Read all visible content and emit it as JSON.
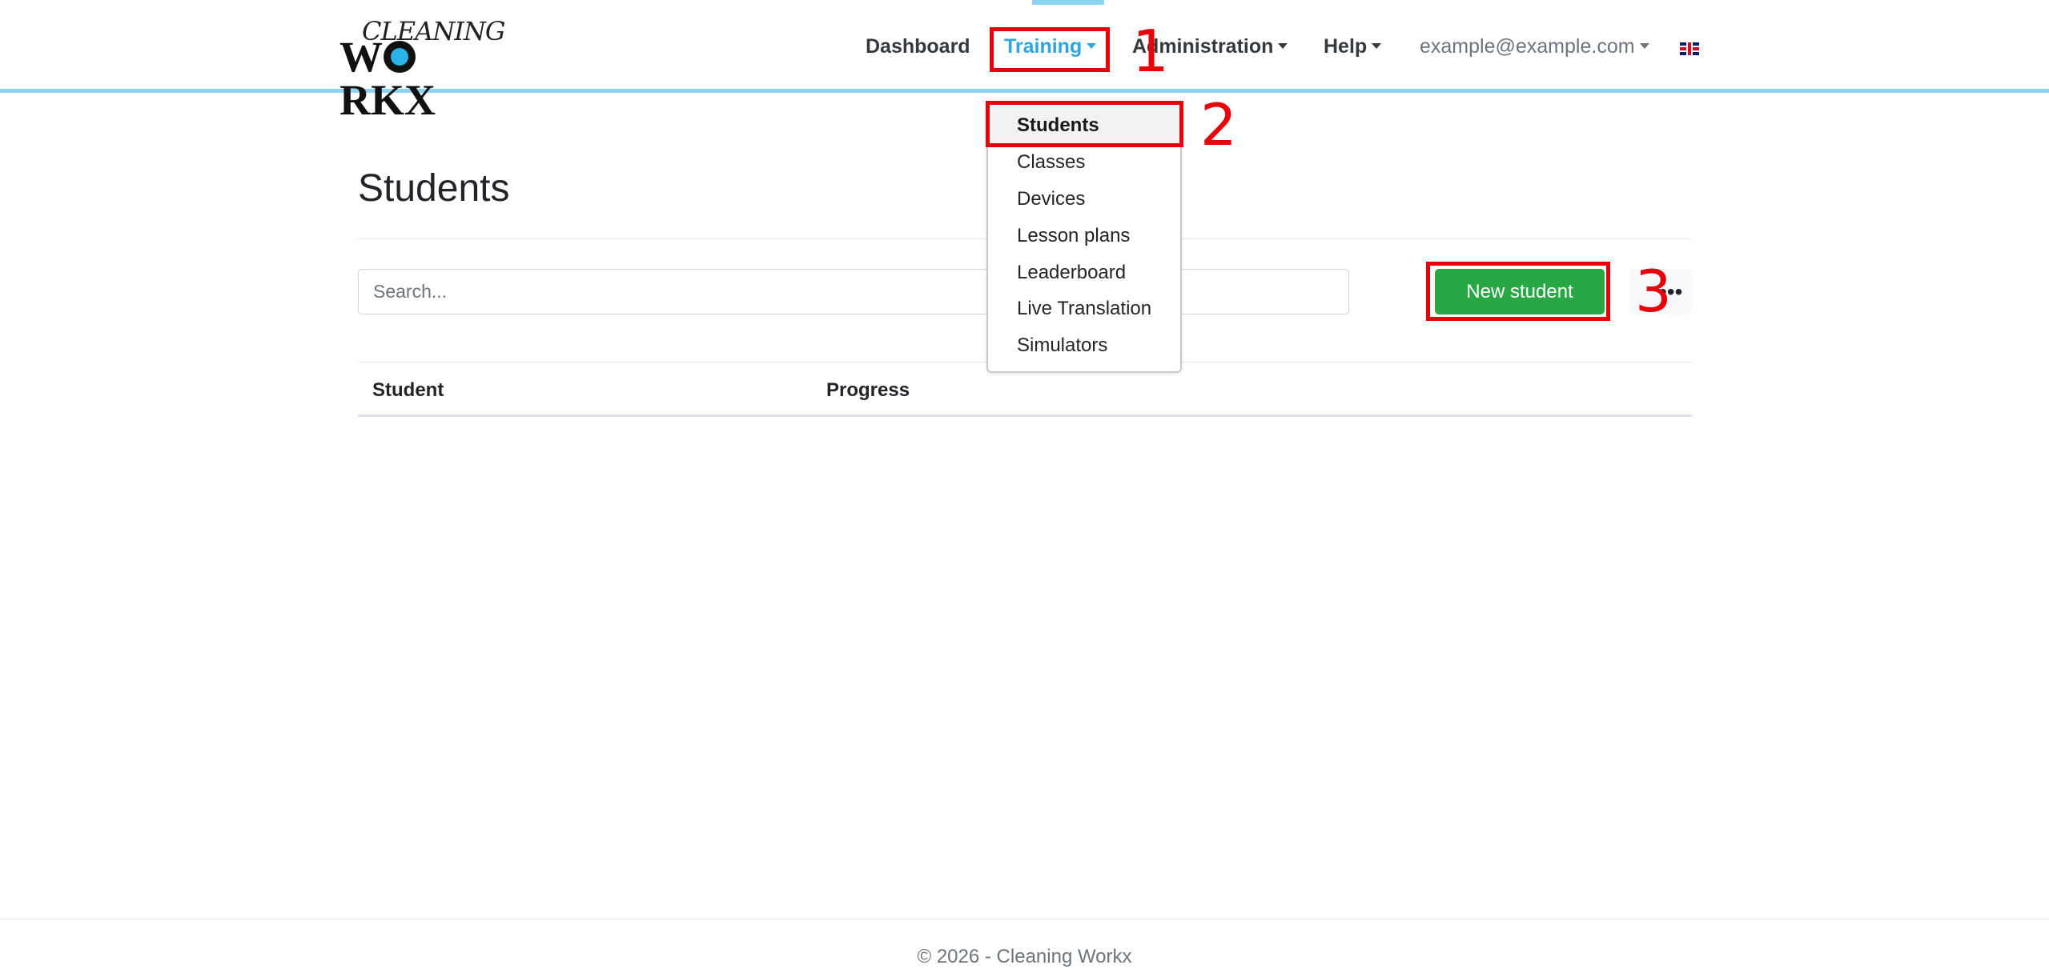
{
  "brand": {
    "logo_top": "CLEANING",
    "logo_bottom_a": "W",
    "logo_bottom_b": "RKX"
  },
  "nav": {
    "dashboard": "Dashboard",
    "training": "Training",
    "administration": "Administration",
    "help": "Help",
    "user": "example@example.com"
  },
  "training_menu": {
    "items": [
      "Students",
      "Classes",
      "Devices",
      "Lesson plans",
      "Leaderboard",
      "Live Translation",
      "Simulators"
    ],
    "active": "Students"
  },
  "annotations": [
    "1",
    "2",
    "3"
  ],
  "main": {
    "title": "Students",
    "search_placeholder": "Search...",
    "new_student_label": "New student",
    "more_label": "•••",
    "columns": [
      "Student",
      "Progress"
    ]
  },
  "footer": {
    "text": "© 2026 - Cleaning Workx"
  },
  "colors": {
    "accent": "#2ba6de",
    "nav_border": "#8fd3f2",
    "success": "#28a745",
    "annotation": "#e8000b"
  }
}
